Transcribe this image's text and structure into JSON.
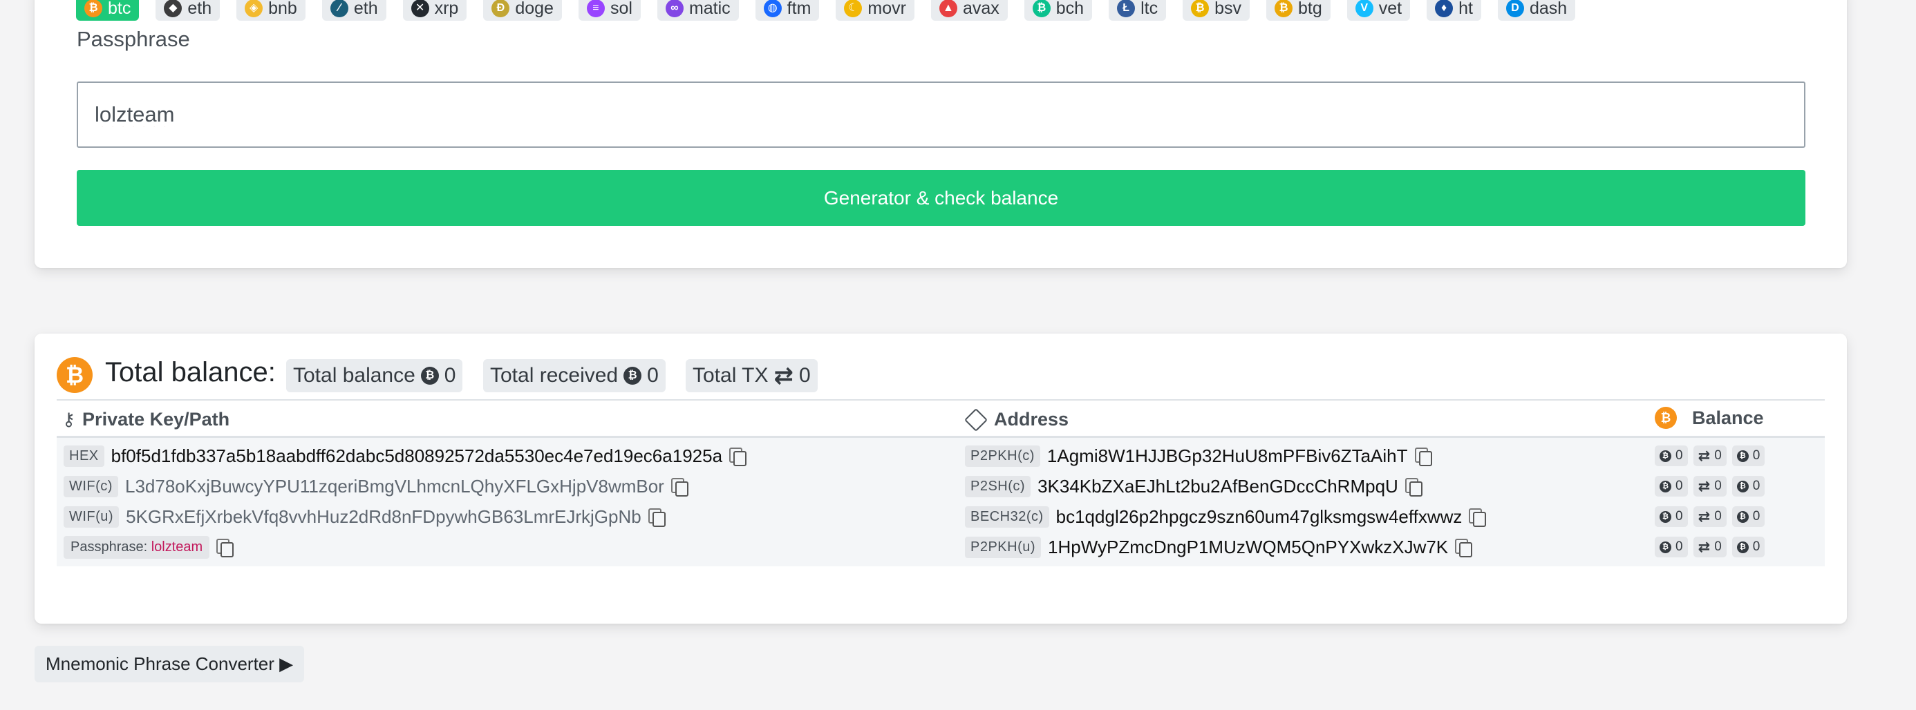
{
  "coins": [
    {
      "label": "btc",
      "icon": "bitcoin-icon",
      "color": "#f7931a",
      "glyph": "₿",
      "active": true
    },
    {
      "label": "eth",
      "icon": "ethereum-icon",
      "color": "#3c3c3d",
      "glyph": "◆",
      "active": false
    },
    {
      "label": "bnb",
      "icon": "bnb-icon",
      "color": "#f3ba2f",
      "glyph": "◈",
      "active": false
    },
    {
      "label": "eth",
      "icon": "ethereum-classic-icon",
      "color": "#1b5e7a",
      "glyph": "∕",
      "active": false
    },
    {
      "label": "xrp",
      "icon": "xrp-icon",
      "color": "#23292f",
      "glyph": "✕",
      "active": false
    },
    {
      "label": "doge",
      "icon": "dogecoin-icon",
      "color": "#c2a633",
      "glyph": "Ð",
      "active": false
    },
    {
      "label": "sol",
      "icon": "solana-icon",
      "color": "#9945ff",
      "glyph": "≡",
      "active": false
    },
    {
      "label": "matic",
      "icon": "polygon-icon",
      "color": "#8247e5",
      "glyph": "∞",
      "active": false
    },
    {
      "label": "ftm",
      "icon": "fantom-icon",
      "color": "#1969ff",
      "glyph": "◍",
      "active": false
    },
    {
      "label": "movr",
      "icon": "moonriver-icon",
      "color": "#f2b705",
      "glyph": "☾",
      "active": false
    },
    {
      "label": "avax",
      "icon": "avalanche-icon",
      "color": "#e84142",
      "glyph": "▲",
      "active": false
    },
    {
      "label": "bch",
      "icon": "bitcoin-cash-icon",
      "color": "#0ac18e",
      "glyph": "₿",
      "active": false
    },
    {
      "label": "ltc",
      "icon": "litecoin-icon",
      "color": "#345d9d",
      "glyph": "Ł",
      "active": false
    },
    {
      "label": "bsv",
      "icon": "bitcoin-sv-icon",
      "color": "#eab300",
      "glyph": "₿",
      "active": false
    },
    {
      "label": "btg",
      "icon": "bitcoin-gold-icon",
      "color": "#eba809",
      "glyph": "₿",
      "active": false
    },
    {
      "label": "vet",
      "icon": "vechain-icon",
      "color": "#15bdff",
      "glyph": "V",
      "active": false
    },
    {
      "label": "ht",
      "icon": "huobi-token-icon",
      "color": "#1c4f9c",
      "glyph": "♦",
      "active": false
    },
    {
      "label": "dash",
      "icon": "dash-icon",
      "color": "#008ce7",
      "glyph": "D",
      "active": false
    }
  ],
  "form": {
    "passphrase_label": "Passphrase",
    "passphrase_value": "lolzteam",
    "generate_button": "Generator & check balance"
  },
  "balance": {
    "title": "Total balance:",
    "total_balance_label": "Total balance",
    "total_balance_value": "0",
    "total_received_label": "Total received",
    "total_received_value": "0",
    "total_tx_label": "Total TX",
    "total_tx_value": "0"
  },
  "table": {
    "col_private_key": "Private Key/Path",
    "col_address": "Address",
    "col_balance": "Balance",
    "rows": [
      {
        "key_tag": "HEX",
        "key_value": "bf0f5d1fdb337a5b18aabdff62dabc5d80892572da5530ec4e7ed19ec6a1925a",
        "addr_tag": "P2PKH(c)",
        "addr_value": "1Agmi8W1HJJBGp32HuU8mPFBiv6ZTaAihT",
        "bal": "0",
        "tx": "0",
        "recv": "0"
      },
      {
        "key_tag": "WIF(c)",
        "key_value": "L3d78oKxjBuwcyYPU11zqeriBmgVLhmcnLQhyXFLGxHjpV8wmBor",
        "addr_tag": "P2SH(c)",
        "addr_value": "3K34KbZXaEJhLt2bu2AfBenGDccChRMpqU",
        "bal": "0",
        "tx": "0",
        "recv": "0"
      },
      {
        "key_tag": "WIF(u)",
        "key_value": "5KGRxEfjXrbekVfq8vvhHuz2dRd8nFDpywhGB63LmrEJrkjGpNb",
        "addr_tag": "BECH32(c)",
        "addr_value": "bc1qdgl26p2hpgcz9szn60um47glksmgsw4effxwwz",
        "bal": "0",
        "tx": "0",
        "recv": "0"
      },
      {
        "pass_label": "Passphrase:",
        "pass_value": "lolzteam",
        "addr_tag": "P2PKH(u)",
        "addr_value": "1HpWyPZmcDngP1MUzWQM5QnPYXwkzXJw7K",
        "bal": "0",
        "tx": "0",
        "recv": "0"
      }
    ]
  },
  "mnemonic_button": "Mnemonic Phrase Converter ▶"
}
